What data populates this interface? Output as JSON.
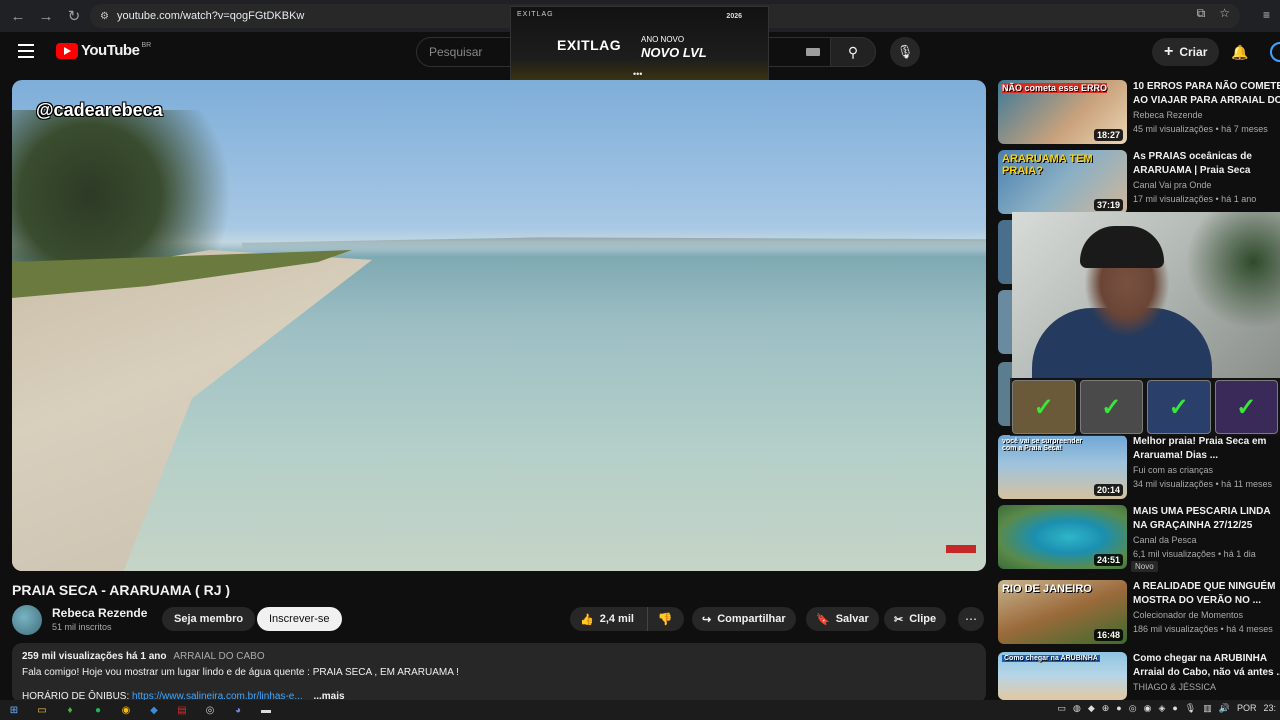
{
  "browser": {
    "url": "youtube.com/watch?v=qogFGtDKBKw"
  },
  "ad": {
    "top_text": "EXITLAG",
    "brand": "EXITLAG",
    "line1": "ANO NOVO",
    "line2": "NOVO LVL",
    "badge": "2026",
    "dots": "•••"
  },
  "header": {
    "logo": "YouTube",
    "region": "BR",
    "search_placeholder": "Pesquisar",
    "create_label": "Criar"
  },
  "player": {
    "watermark": "@cadearebeca"
  },
  "video": {
    "title": "PRAIA SECA - ARARUAMA ( RJ )",
    "channel": "Rebeca Rezende",
    "subscribers": "51 mil inscritos",
    "join_label": "Seja membro",
    "subscribe_label": "Inscrever-se",
    "likes": "2,4 mil",
    "share_label": "Compartilhar",
    "save_label": "Salvar",
    "clip_label": "Clipe"
  },
  "description": {
    "meta": "259 mil visualizações  há 1 ano",
    "tag": "ARRAIAL DO CABO",
    "line1": "Fala comigo! Hoje vou mostrar um lugar lindo e de água quente : PRAIA SECA , EM ARARUAMA !",
    "line2_prefix": "HORÁRIO DE ÔNIBUS:",
    "line2_link": "https://www.salineira.com.br/linhas-e...",
    "more": "...mais"
  },
  "recommendations": [
    {
      "title": "10 ERROS PARA NÃO COMETER AO VIAJAR PARA ARRAIAL DO...",
      "title2": "AO VIAJAR PARA ARRAIAL DO",
      "channel": "Rebeca Rezende",
      "meta": "45 mil visualizações • há 7 meses",
      "duration": "18:27",
      "thumb_text": "NÃO cometa esse ERRO"
    },
    {
      "title": "As PRAIAS oceânicas de",
      "title2": "ARARUAMA | Praia Seca",
      "channel": "Canal Vai pra Onde",
      "meta": "17 mil visualizações • há 1 ano",
      "duration": "37:19",
      "thumb_text": "ARARUAMA TEM PRAIA?"
    },
    {
      "title": "Melhor praia! Praia Seca em",
      "title2": "Araruama! Dias ...",
      "channel": "Fui com as crianças",
      "meta": "34 mil visualizações • há 11 meses",
      "duration": "20:14",
      "thumb_text": "você vai se surpreender com a Praia Seca!"
    },
    {
      "title": "MAIS UMA PESCARIA LINDA",
      "title2": "NA GRAÇAINHA 27/12/25",
      "channel": "Canal da Pesca",
      "meta": "6,1 mil visualizações • há 1 dia",
      "duration": "24:51",
      "thumb_text": "",
      "badge": "Novo"
    },
    {
      "title": "A REALIDADE QUE NINGUÉM",
      "title2": "MOSTRA DO VERÃO NO ...",
      "channel": "Colecionador de Momentos",
      "meta": "186 mil visualizações • há 4 meses",
      "duration": "16:48",
      "thumb_text": "RIO DE JANEIRO"
    },
    {
      "title": "Como chegar na ARUBINHA",
      "title2": "Arraial do Cabo, não vá antes ...",
      "channel": "THIAGO & JÉSSICA",
      "meta": "",
      "duration": "",
      "thumb_text": "Como chegar na ARUBINHA"
    }
  ],
  "taskbar": {
    "lang": "POR",
    "time": "23:"
  }
}
